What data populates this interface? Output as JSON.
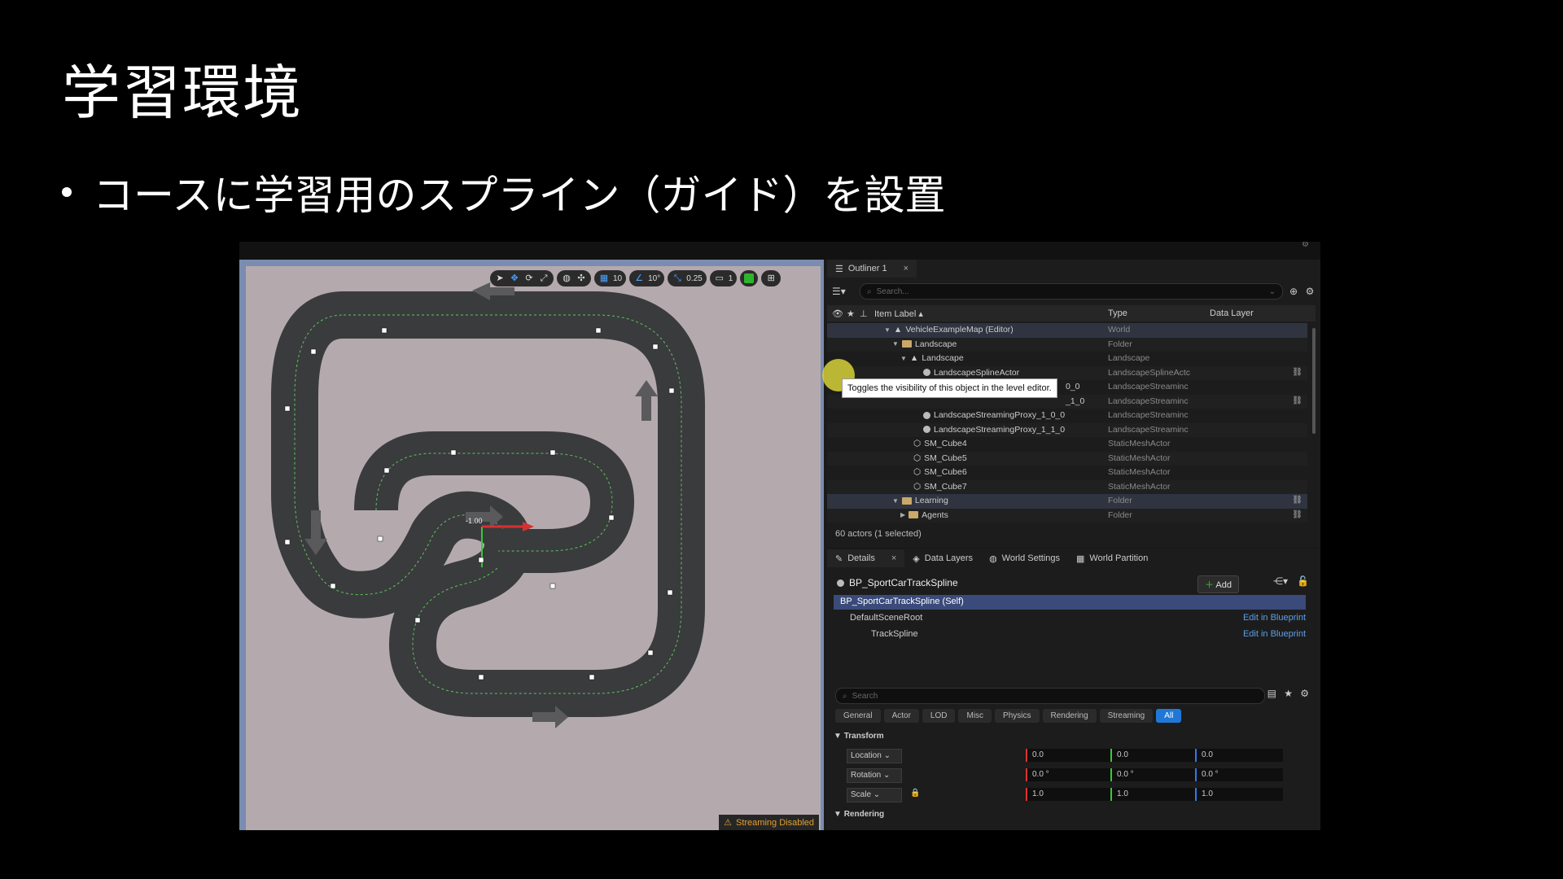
{
  "slide": {
    "title": "学習環境",
    "bullet": "コースに学習用のスプライン（ガイド）を設置"
  },
  "viewport": {
    "toolbar": {
      "grid_snap": "10",
      "rotate_snap": "10°",
      "scale_snap": "0.25",
      "camera_speed": "1"
    },
    "gizmo_label": "-1.00",
    "streaming_warning": "Streaming Disabled"
  },
  "outliner": {
    "tab_label": "Outliner 1",
    "search_placeholder": "Search...",
    "columns": {
      "label": "Item Label ▴",
      "type": "Type",
      "data_layer": "Data Layer"
    },
    "rows": [
      {
        "label": "VehicleExampleMap (Editor)",
        "type": "World"
      },
      {
        "label": "Landscape",
        "type": "Folder"
      },
      {
        "label": "Landscape",
        "type": "Landscape"
      },
      {
        "label": "LandscapeSplineActor",
        "type": "LandscapeSplineActc"
      },
      {
        "label": "0_0",
        "type": "LandscapeStreaminc"
      },
      {
        "label": "_1_0",
        "type": "LandscapeStreaminc"
      },
      {
        "label": "LandscapeStreamingProxy_1_0_0",
        "type": "LandscapeStreaminc"
      },
      {
        "label": "LandscapeStreamingProxy_1_1_0",
        "type": "LandscapeStreaminc"
      },
      {
        "label": "SM_Cube4",
        "type": "StaticMeshActor"
      },
      {
        "label": "SM_Cube5",
        "type": "StaticMeshActor"
      },
      {
        "label": "SM_Cube6",
        "type": "StaticMeshActor"
      },
      {
        "label": "SM_Cube7",
        "type": "StaticMeshActor"
      },
      {
        "label": "Learning",
        "type": "Folder"
      },
      {
        "label": "Agents",
        "type": "Folder"
      }
    ],
    "tooltip": "Toggles the visibility of this object in the level editor.",
    "status": "60 actors (1 selected)"
  },
  "details": {
    "tabs": [
      "Details",
      "Data Layers",
      "World Settings",
      "World Partition"
    ],
    "object_name": "BP_SportCarTrackSpline",
    "add_label": "Add",
    "components": [
      {
        "label": "BP_SportCarTrackSpline (Self)",
        "edit": ""
      },
      {
        "label": "DefaultSceneRoot",
        "edit": "Edit in Blueprint"
      },
      {
        "label": "TrackSpline",
        "edit": "Edit in Blueprint"
      }
    ],
    "search_placeholder": "Search",
    "filter_tabs": [
      "General",
      "Actor",
      "LOD",
      "Misc",
      "Physics",
      "Rendering",
      "Streaming",
      "All"
    ],
    "sections": {
      "transform": "Transform",
      "rendering": "Rendering"
    },
    "props": [
      {
        "label": "Location",
        "x": "0.0",
        "y": "0.0",
        "z": "0.0"
      },
      {
        "label": "Rotation",
        "x": "0.0 °",
        "y": "0.0 °",
        "z": "0.0 °"
      },
      {
        "label": "Scale",
        "x": "1.0",
        "y": "1.0",
        "z": "1.0"
      }
    ]
  }
}
